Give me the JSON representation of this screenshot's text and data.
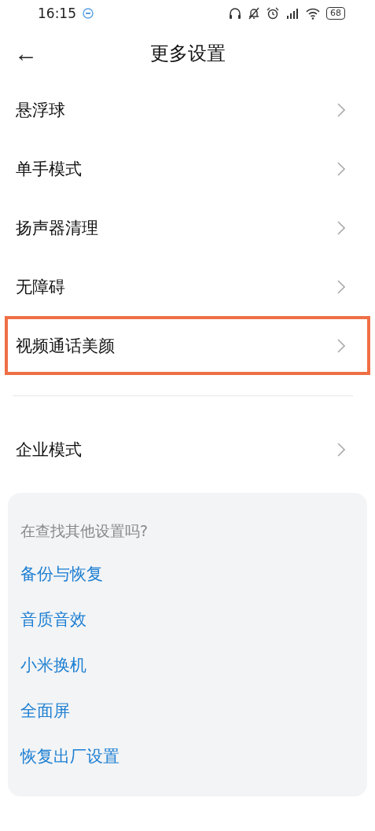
{
  "status_bar": {
    "time": "16:15",
    "battery": "68"
  },
  "header": {
    "back": "←",
    "title": "更多设置"
  },
  "settings": [
    {
      "label": "悬浮球",
      "highlighted": false
    },
    {
      "label": "单手模式",
      "highlighted": false
    },
    {
      "label": "扬声器清理",
      "highlighted": false
    },
    {
      "label": "无障碍",
      "highlighted": false
    },
    {
      "label": "视频通话美颜",
      "highlighted": true
    }
  ],
  "settings_2": [
    {
      "label": "企业模式",
      "highlighted": false
    }
  ],
  "suggestions": {
    "title": "在查找其他设置吗?",
    "links": [
      "备份与恢复",
      "音质音效",
      "小米换机",
      "全面屏",
      "恢复出厂设置"
    ]
  }
}
